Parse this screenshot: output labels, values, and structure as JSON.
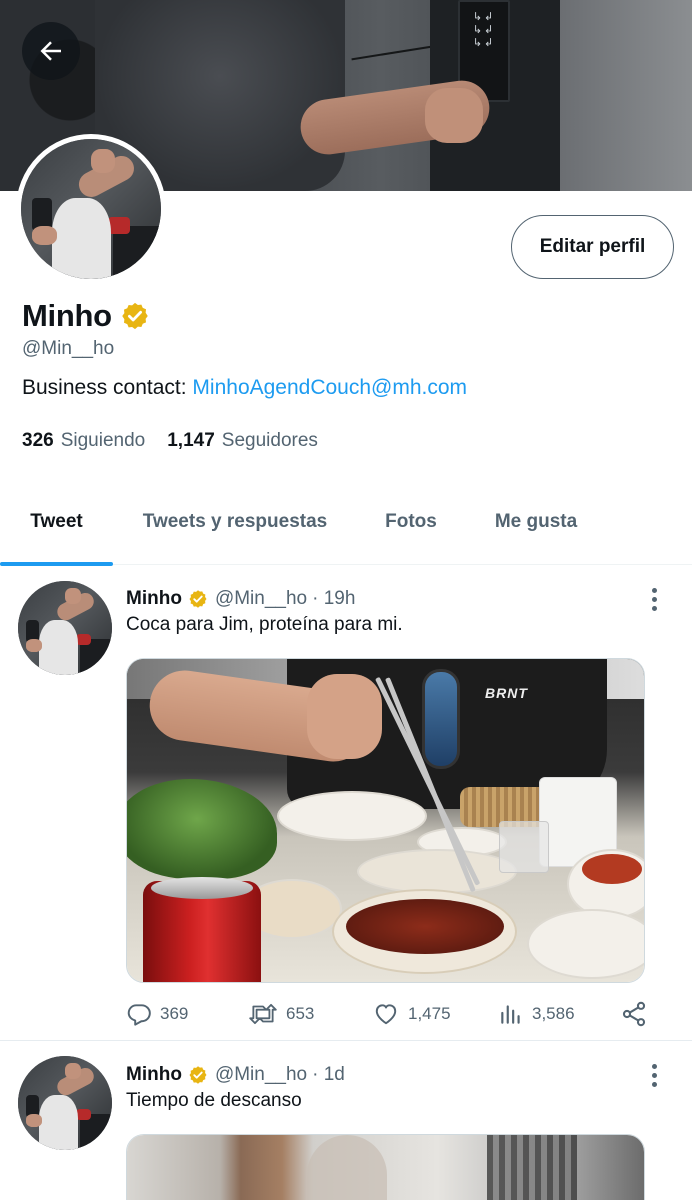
{
  "profile": {
    "display_name": "Minho",
    "handle": "@Min__ho",
    "bio_prefix": "Business contact: ",
    "bio_link": "MinhoAgendCouch@mh.com",
    "edit_label": "Editar perfil",
    "following_count": "326",
    "following_label": "Siguiendo",
    "followers_count": "1,147",
    "followers_label": "Seguidores",
    "verified": true
  },
  "banner": {
    "panel_glyphs": "↳↲\n↳↲\n↳↲"
  },
  "tabs": [
    {
      "label": "Tweet",
      "active": true
    },
    {
      "label": "Tweets y respuestas",
      "active": false
    },
    {
      "label": "Fotos",
      "active": false
    },
    {
      "label": "Me gusta",
      "active": false
    }
  ],
  "tweets": [
    {
      "name": "Minho",
      "handle": "@Min__ho",
      "time": "· 19h",
      "text": "Coca para Jim, proteína para mi.",
      "photo_brand": "BRNT",
      "replies": "369",
      "retweets": "653",
      "likes": "1,475",
      "views": "3,586"
    },
    {
      "name": "Minho",
      "handle": "@Min__ho",
      "time": "· 1d",
      "text": "Tiempo de descanso"
    }
  ],
  "icons": {
    "back": "back-arrow-icon",
    "verified": "verified-badge-icon",
    "more": "more-vertical-icon",
    "reply": "reply-icon",
    "retweet": "retweet-icon",
    "like": "heart-icon",
    "views": "views-icon",
    "share": "share-icon"
  },
  "colors": {
    "accent": "#1d9bf0",
    "verified": "#e8b513",
    "text_primary": "#0f1419",
    "text_secondary": "#536471"
  }
}
